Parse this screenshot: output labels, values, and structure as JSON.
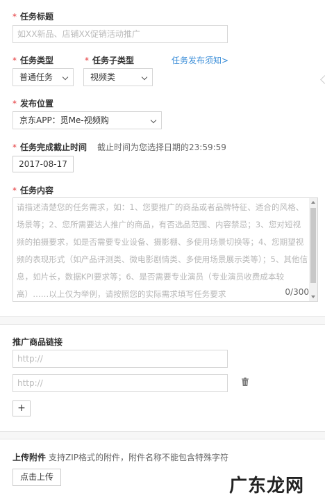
{
  "task_title": {
    "label": "任务标题",
    "placeholder": "如XX新品、店铺XX促销活动推广"
  },
  "task_type": {
    "label": "任务类型",
    "value": "普通任务"
  },
  "task_subtype": {
    "label": "任务子类型",
    "value": "视频类"
  },
  "publish_notice_link": "任务发布须知>",
  "publish_position": {
    "label": "发布位置",
    "value": "京东APP：觅Me-视频购"
  },
  "deadline": {
    "label": "任务完成截止时间",
    "hint": "截止时间为您选择日期的23:59:59",
    "value": "2017-08-17"
  },
  "task_content": {
    "label": "任务内容",
    "placeholder": "请描述清楚您的任务需求，如：1、您要推广的商品或者品牌特征、适合的风格、场景等；2、您所需要达人推广的商品，有否选品范围、内容禁忌；3、您对短视频的拍摄要求，如是否需要专业设备、摄影棚、多使用场景切换等；4、您期望视频的表现形式（如产品评测类、微电影剧情类、多使用场景展示类等）；5、其他信息，如片长，数据KPI要求等；6、是否需要专业演员（专业演员收费成本较高）……以上仅为举例，请按照您的实际需求填写任务要求",
    "counter": "0/300"
  },
  "promo_links": {
    "label": "推广商品链接",
    "placeholders": [
      "http://",
      "http://"
    ],
    "add_label": "+"
  },
  "attachment": {
    "label": "上传附件",
    "hint": "支持ZIP格式的附件，附件名称不能包含特殊字符",
    "button": "点击上传"
  },
  "required_mark": "*",
  "watermark": "广东龙网",
  "icons": {
    "dropdown": "chevron-down-icon",
    "delete": "trash-icon",
    "side_arrow": "chevron-left-icon"
  },
  "colors": {
    "required": "#e4393c",
    "link": "#3b8ed8",
    "border": "#d6d6d6"
  }
}
